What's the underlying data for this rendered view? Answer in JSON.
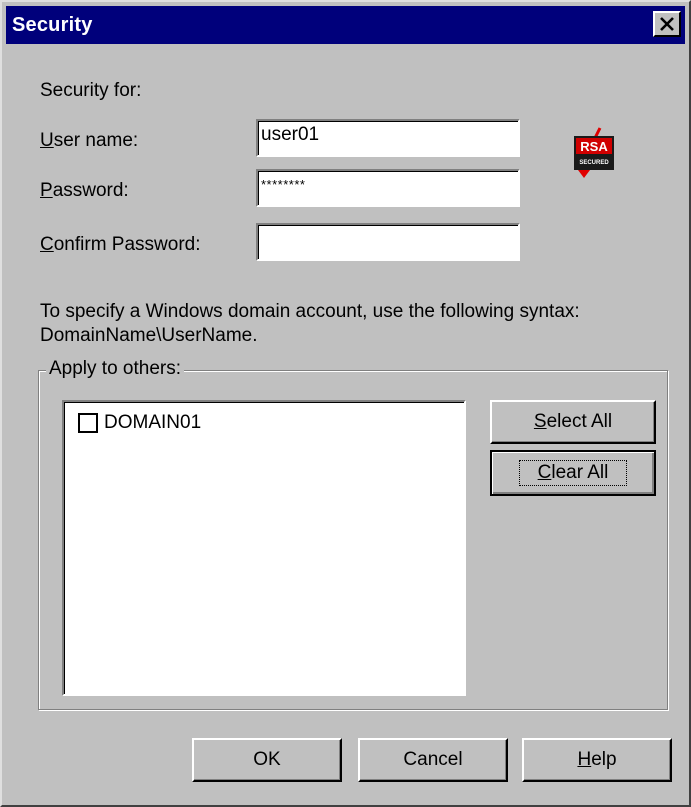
{
  "window": {
    "title": "Security",
    "title_bar_color": "#00007b"
  },
  "form": {
    "security_for_label": "Security for:",
    "user_name": {
      "label_prefix": "U",
      "label_rest": "ser name:",
      "value": "user01"
    },
    "password": {
      "label_prefix": "P",
      "label_rest": "assword:",
      "value": "********"
    },
    "confirm_password": {
      "label_prefix": "C",
      "label_rest": "onfirm Password:",
      "value": ""
    }
  },
  "logo": {
    "name": "RSA Secured",
    "text": "RSA",
    "subtext": "SECURED"
  },
  "note": {
    "line1": "To specify a Windows domain account, use the following syntax:",
    "line2": "DomainName\\UserName."
  },
  "apply_group": {
    "legend": "Apply to others:",
    "items": [
      {
        "label": "DOMAIN01",
        "checked": false
      }
    ],
    "select_all": {
      "prefix": "S",
      "rest": "elect All"
    },
    "clear_all": {
      "prefix": "C",
      "rest": "lear All"
    }
  },
  "footer": {
    "ok_label": "OK",
    "cancel_label": "Cancel",
    "help_prefix": "H",
    "help_rest": "elp"
  },
  "icons": {
    "close": "close-icon",
    "checkbox": "checkbox-icon",
    "logo": "rsa-secured-logo"
  }
}
